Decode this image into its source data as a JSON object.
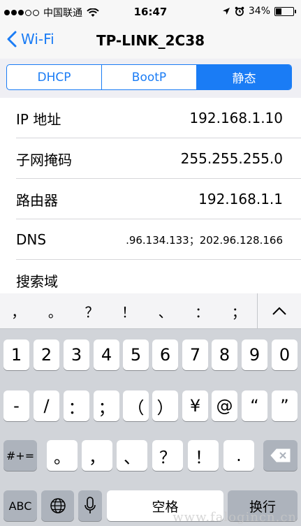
{
  "status": {
    "carrier": "中国联通",
    "time": "16:47",
    "battery": "34%",
    "battery_level": 0.34
  },
  "nav": {
    "back_label": "Wi-Fi",
    "title": "TP-LINK_2C38"
  },
  "segments": [
    {
      "label": "DHCP"
    },
    {
      "label": "BootP"
    },
    {
      "label": "静态"
    }
  ],
  "fields": [
    {
      "label": "IP 地址",
      "value": "192.168.1.10"
    },
    {
      "label": "子网掩码",
      "value": "255.255.255.0"
    },
    {
      "label": "路由器",
      "value": "192.168.1.1"
    },
    {
      "label": "DNS",
      "value": ".96.134.133；202.96.128.166"
    },
    {
      "label": "搜索域",
      "value": ""
    }
  ],
  "keyboard": {
    "candidates": [
      "，",
      "。",
      "？",
      "！",
      "、",
      "：",
      "；"
    ],
    "row1": [
      "1",
      "2",
      "3",
      "4",
      "5",
      "6",
      "7",
      "8",
      "9",
      "0"
    ],
    "row2": [
      "-",
      "/",
      "：",
      "；",
      "（",
      "）",
      "¥",
      "@",
      "“",
      "”"
    ],
    "row3": [
      "。",
      "，",
      "、",
      "？",
      "！",
      "."
    ],
    "mode_key": "#+=",
    "abc_key": "ABC",
    "space_key": "空格",
    "return_key": "换行"
  },
  "watermark": "www.falogincn.cn"
}
